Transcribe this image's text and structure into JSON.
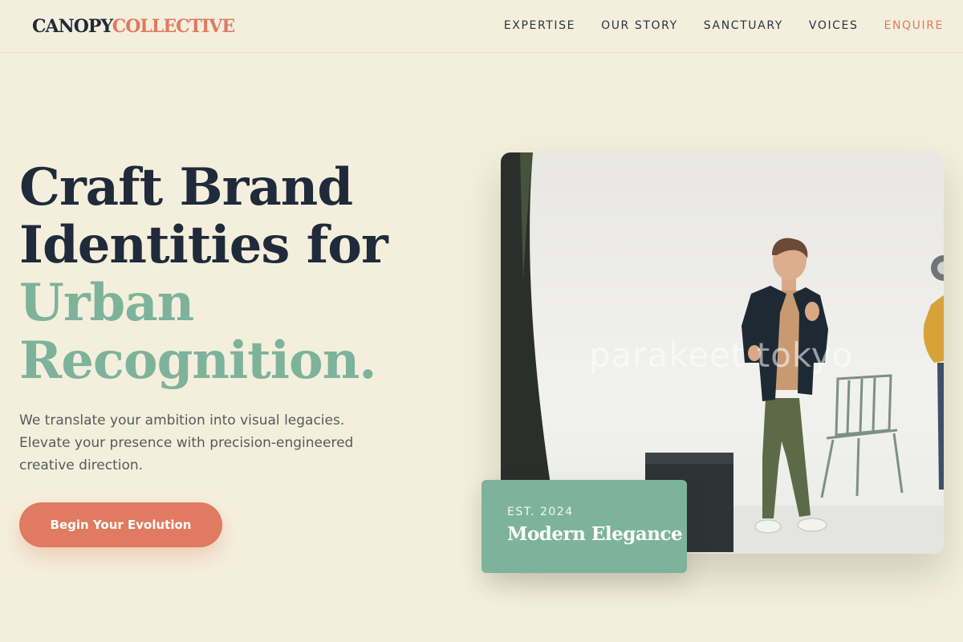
{
  "brand": {
    "part1": "CANOPY",
    "part2": "COLLECTIVE"
  },
  "nav": {
    "items": [
      {
        "label": "EXPERTISE"
      },
      {
        "label": "OUR STORY"
      },
      {
        "label": "SANCTUARY"
      },
      {
        "label": "VOICES"
      },
      {
        "label": "ENQUIRE"
      }
    ]
  },
  "hero": {
    "headline": {
      "line1": "Craft Brand",
      "line2": "Identities for",
      "line3": "Urban",
      "line4": "Recognition."
    },
    "subtext": "We translate your ambition into visual legacies. Elevate your presence with precision-engineered creative direction.",
    "cta_label": "Begin Your Evolution"
  },
  "image": {
    "watermark": "parakeet tokyo"
  },
  "badge": {
    "est": "EST. 2024",
    "title": "Modern Elegance"
  },
  "colors": {
    "background": "#f4efdc",
    "navy": "#1f2a3a",
    "coral": "#e07a60",
    "sage": "#7db39a"
  }
}
